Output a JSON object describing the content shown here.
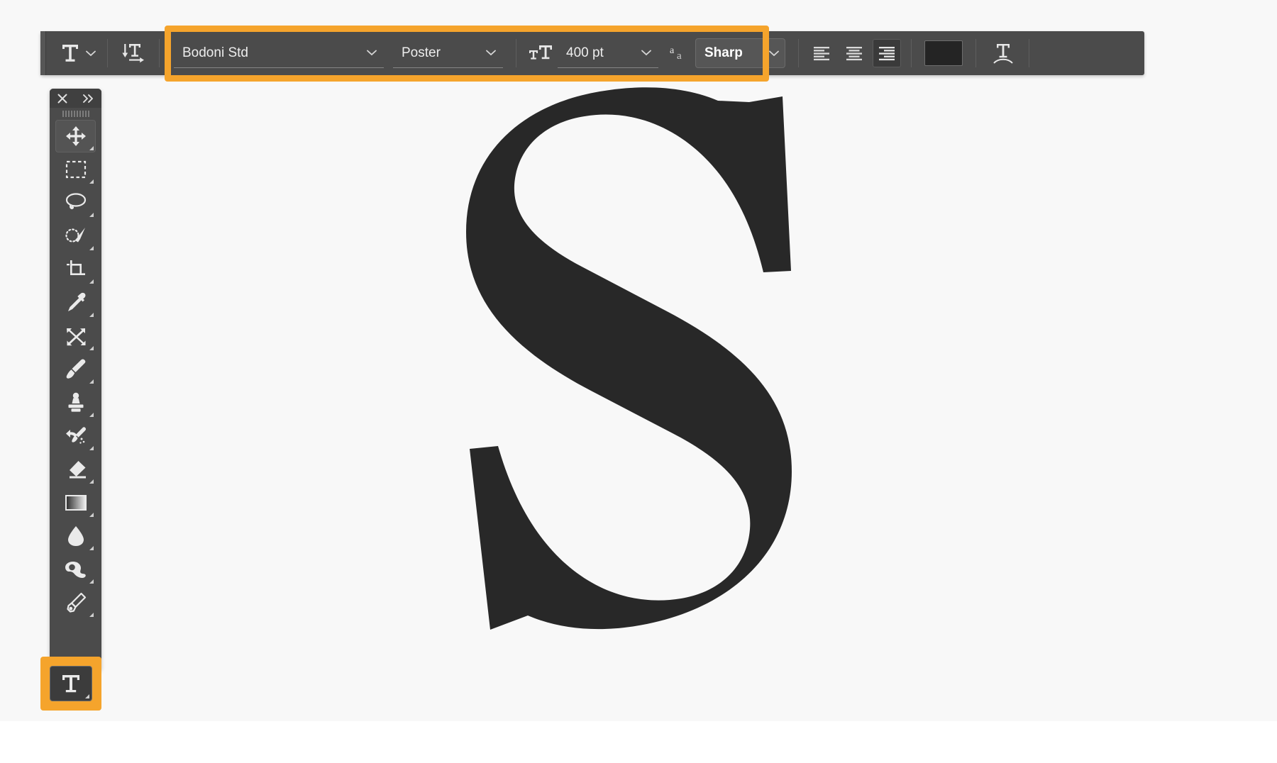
{
  "app": {
    "canvas_bg": "#f8f8f8",
    "highlight_color": "#f5a42c",
    "panel_bg": "#4b4b4b",
    "glyph_color": "#282828"
  },
  "options_bar": {
    "tool_preset": {
      "label": "T",
      "icon": "type-tool-icon"
    },
    "tool_preset_caret": "chevron-down-icon",
    "orientation_toggle": {
      "icon": "toggle-text-orientation-icon",
      "title": "Toggle text orientation"
    },
    "font_family": {
      "label": "Font family",
      "value": "Bodoni Std",
      "caret": "chevron-down-icon"
    },
    "font_style": {
      "label": "Font style",
      "value": "Poster",
      "caret": "chevron-down-icon"
    },
    "font_size": {
      "label": "Font size",
      "icon": "font-size-icon",
      "value": "400 pt",
      "caret": "chevron-down-icon"
    },
    "anti_alias": {
      "label": "Anti-aliasing",
      "icon": "anti-alias-icon",
      "value": "Sharp",
      "caret": "chevron-down-icon"
    },
    "alignment": [
      {
        "name": "align-left",
        "selected": false
      },
      {
        "name": "align-center",
        "selected": false
      },
      {
        "name": "align-right",
        "selected": true
      }
    ],
    "text_color": {
      "label": "Text color",
      "value": "#242424"
    },
    "warp_text": {
      "label": "Create warped text",
      "icon": "warp-text-icon"
    }
  },
  "tools_panel": {
    "close_label": "×",
    "expand_label": "»",
    "items": [
      {
        "name": "move-tool",
        "icon": "move-icon",
        "active": true,
        "has_flyout": true
      },
      {
        "name": "rectangular-marquee-tool",
        "icon": "marquee-icon",
        "active": false,
        "has_flyout": true
      },
      {
        "name": "lasso-tool",
        "icon": "lasso-icon",
        "active": false,
        "has_flyout": true
      },
      {
        "name": "quick-selection-tool",
        "icon": "quick-selection-icon",
        "active": false,
        "has_flyout": true
      },
      {
        "name": "crop-tool",
        "icon": "crop-icon",
        "active": false,
        "has_flyout": true
      },
      {
        "name": "eyedropper-tool",
        "icon": "eyedropper-icon",
        "active": false,
        "has_flyout": true
      },
      {
        "name": "healing-brush-tool",
        "icon": "healing-brush-icon",
        "active": false,
        "has_flyout": true
      },
      {
        "name": "brush-tool",
        "icon": "brush-icon",
        "active": false,
        "has_flyout": true
      },
      {
        "name": "clone-stamp-tool",
        "icon": "clone-stamp-icon",
        "active": false,
        "has_flyout": true
      },
      {
        "name": "history-brush-tool",
        "icon": "history-brush-icon",
        "active": false,
        "has_flyout": true
      },
      {
        "name": "eraser-tool",
        "icon": "eraser-icon",
        "active": false,
        "has_flyout": true
      },
      {
        "name": "gradient-tool",
        "icon": "gradient-icon",
        "active": false,
        "has_flyout": true
      },
      {
        "name": "blur-tool",
        "icon": "blur-drop-icon",
        "active": false,
        "has_flyout": true
      },
      {
        "name": "dodge-tool",
        "icon": "dodge-icon",
        "active": false,
        "has_flyout": true
      },
      {
        "name": "pen-tool",
        "icon": "pen-icon",
        "active": false,
        "has_flyout": true
      }
    ],
    "type_tool": {
      "name": "type-tool",
      "icon": "type-tool-icon",
      "label": "T",
      "highlighted": true,
      "has_flyout": true
    }
  },
  "canvas": {
    "glyph": "S",
    "glyph_font": "Bodoni Std Poster",
    "glyph_size": "400 pt"
  }
}
